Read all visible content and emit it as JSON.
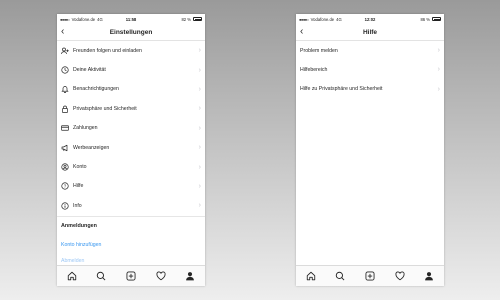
{
  "left_phone": {
    "status": {
      "carrier": "Vodafone.de",
      "network": "4G",
      "time": "11:58",
      "battery": "82 %"
    },
    "title": "Einstellungen",
    "menu": [
      {
        "label": "Freunden folgen und einladen",
        "icon": "add-person-icon"
      },
      {
        "label": "Deine Aktivität",
        "icon": "activity-icon"
      },
      {
        "label": "Benachrichtigungen",
        "icon": "bell-icon"
      },
      {
        "label": "Privatsphäre und Sicherheit",
        "icon": "lock-icon"
      },
      {
        "label": "Zahlungen",
        "icon": "card-icon"
      },
      {
        "label": "Werbeanzeigen",
        "icon": "megaphone-icon"
      },
      {
        "label": "Konto",
        "icon": "account-icon"
      },
      {
        "label": "Hilfe",
        "icon": "help-icon"
      },
      {
        "label": "Info",
        "icon": "info-icon"
      }
    ],
    "section_title": "Anmeldungen",
    "add_account": "Konto hinzufügen",
    "logout": "Abmelden"
  },
  "right_phone": {
    "status": {
      "carrier": "Vodafone.de",
      "network": "4G",
      "time": "12:02",
      "battery": "86 %"
    },
    "title": "Hilfe",
    "menu": [
      {
        "label": "Problem melden"
      },
      {
        "label": "Hilfebereich"
      },
      {
        "label": "Hilfe zu Privatsphäre und Sicherheit"
      }
    ]
  },
  "tabbar": [
    "home-icon",
    "search-icon",
    "add-post-icon",
    "heart-icon",
    "profile-icon"
  ],
  "colors": {
    "link": "#3897f0",
    "chevron": "#c7c7cc",
    "text": "#262626"
  }
}
